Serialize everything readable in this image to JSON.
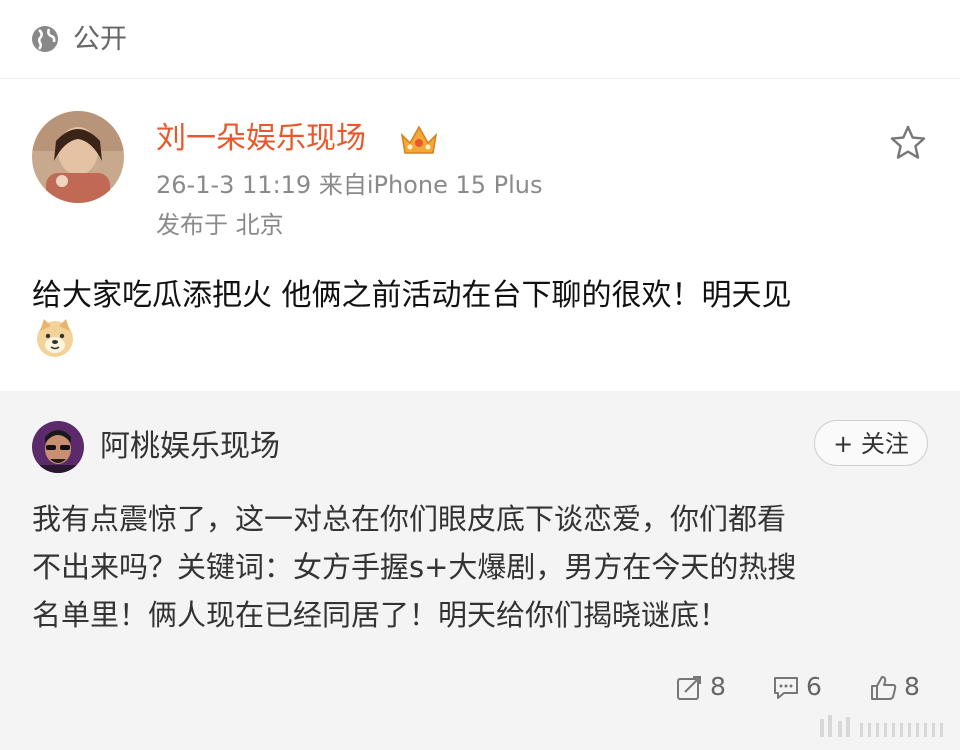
{
  "header": {
    "visibility_label": "公开"
  },
  "post": {
    "author": "刘一朵娱乐现场",
    "meta": "26-1-3 11:19  来自iPhone 15 Plus",
    "location": "发布于 北京",
    "text": "给大家吃瓜添把火 他俩之前活动在台下聊的很欢！明天见"
  },
  "repost": {
    "author": "阿桃娱乐现场",
    "follow_label": "+ 关注",
    "text_lines": [
      "我有点震惊了，这一对总在你们眼皮底下谈恋爱，你们都看",
      "不出来吗？关键词：女方手握s+大爆剧，男方在今天的热搜",
      "名单里！俩人现在已经同居了！明天给你们揭晓谜底！"
    ],
    "reposts": "8",
    "comments": "6",
    "likes": "8"
  },
  "colors": {
    "author_accent": "#e8582a",
    "repost_bg": "#f4f4f4"
  }
}
